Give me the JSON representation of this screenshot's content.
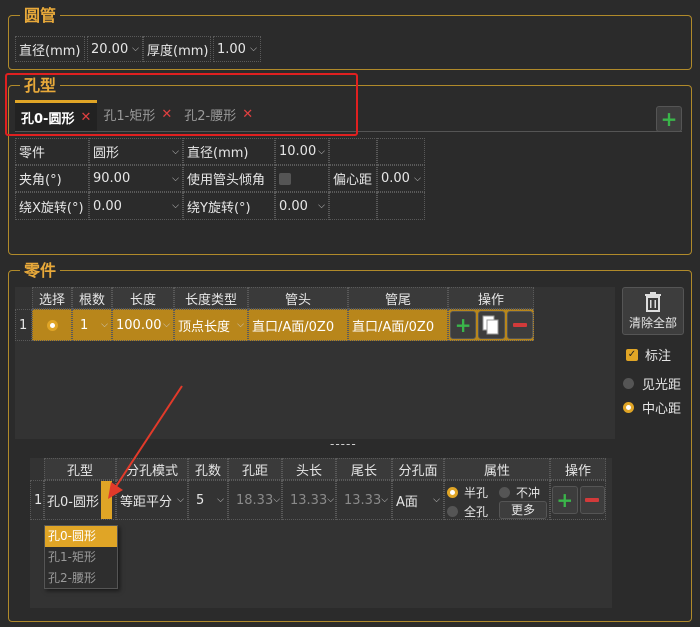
{
  "round_tube": {
    "title": "圆管",
    "diameter_label": "直径(mm)",
    "diameter_value": "20.00",
    "thickness_label": "厚度(mm)",
    "thickness_value": "1.00"
  },
  "hole_type": {
    "title": "孔型",
    "tabs": [
      {
        "label": "孔0-圆形",
        "close": "✕"
      },
      {
        "label": "孔1-矩形",
        "close": "✕"
      },
      {
        "label": "孔2-腰形",
        "close": "✕"
      }
    ],
    "add_label": "+",
    "part_label": "零件",
    "part_value": "圆形",
    "diameter_label": "直径(mm)",
    "diameter_value": "10.00",
    "angle_label": "夹角(°)",
    "angle_value": "90.00",
    "use_head_tilt_label": "使用管头倾角",
    "eccentric_label": "偏心距",
    "eccentric_value": "0.00",
    "rotx_label": "绕X旋转(°)",
    "rotx_value": "0.00",
    "roty_label": "绕Y旋转(°)",
    "roty_value": "0.00"
  },
  "parts": {
    "title": "零件",
    "headers": [
      "选择",
      "根数",
      "长度",
      "长度类型",
      "管头",
      "管尾",
      "操作"
    ],
    "row": {
      "index": "1",
      "count": "1",
      "length": "100.00",
      "length_type": "顶点长度",
      "head": "直口/A面/0Z0",
      "tail": "直口/A面/0Z0"
    },
    "clear_all": "清除全部",
    "annotate": "标注",
    "see_light_dist": "见光距",
    "center_dist": "中心距",
    "splitter": "-----"
  },
  "hole_table": {
    "headers": [
      "孔型",
      "分孔模式",
      "孔数",
      "孔距",
      "头长",
      "尾长",
      "分孔面",
      "属性",
      "操作"
    ],
    "row": {
      "index": "1",
      "hole_type": "孔0-圆形",
      "split_mode": "等距平分",
      "hole_count": "5",
      "hole_spacing": "18.33",
      "head_len": "13.33",
      "tail_len": "13.33",
      "split_face": "A面",
      "half_hole": "半孔",
      "no_punch": "不冲",
      "full_hole": "全孔",
      "more": "更多"
    },
    "dropdown_options": [
      "孔0-圆形",
      "孔1-矩形",
      "孔2-腰形"
    ]
  },
  "colors": {
    "accent": "#e0a526",
    "highlight_box": "#e02020",
    "arrow": "#e23a2a",
    "add_green": "#3ab54a",
    "delete_red": "#d23a3a"
  }
}
